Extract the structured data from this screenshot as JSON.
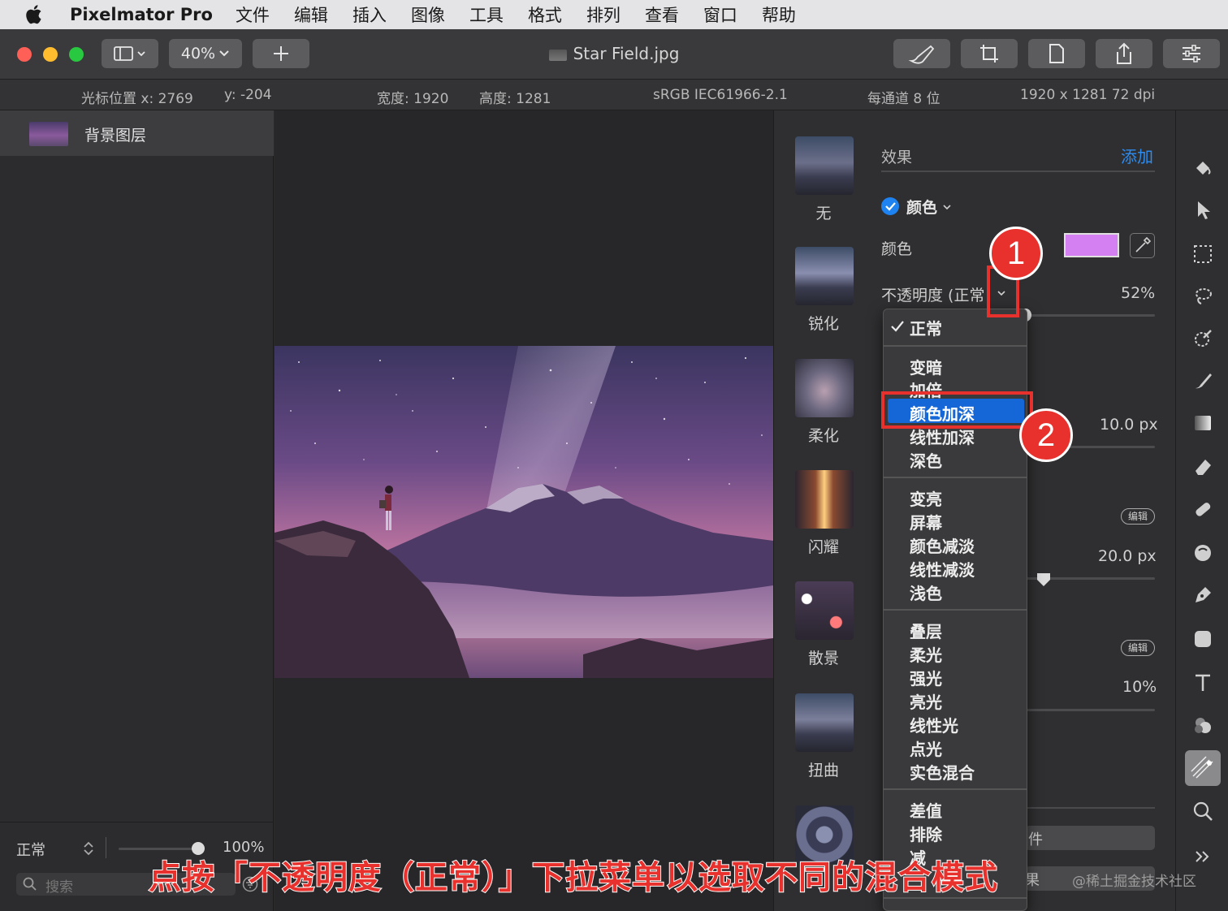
{
  "menubar": {
    "app_name": "Pixelmator Pro",
    "items": [
      "文件",
      "编辑",
      "插入",
      "图像",
      "工具",
      "格式",
      "排列",
      "查看",
      "窗口",
      "帮助"
    ]
  },
  "toolbar": {
    "zoom": "40%",
    "doc_title": "Star Field.jpg"
  },
  "infobar": {
    "cursor_x": "光标位置 x:  2769",
    "cursor_y": "y:  -204",
    "width": "宽度:  1920",
    "height": "高度:  1281",
    "profile": "sRGB IEC61966-2.1",
    "depth": "每通道 8 位",
    "size": "1920 x 1281 72 dpi"
  },
  "layers": {
    "layer_name": "背景图层",
    "blend_mode": "正常",
    "opacity": "100%",
    "opacity_value": 1.0,
    "search_placeholder": "搜索"
  },
  "effects_col": {
    "items": [
      "无",
      "锐化",
      "柔化",
      "闪耀",
      "散景",
      "扭曲"
    ]
  },
  "settings": {
    "header": "效果",
    "add": "添加",
    "effect_name": "颜色",
    "color_label": "颜色",
    "swatch_color": "#d580f2",
    "opacity_label": "不透明度 (正常",
    "opacity_value": "52%",
    "value_px1": "10.0 px",
    "edit_label": "编辑",
    "value_px2": "20.0 px",
    "value_pct": "10%",
    "partial_text1": "件",
    "partial_text2": "果"
  },
  "blend_menu": {
    "checked": "正常",
    "group1": [
      "变暗",
      "加倍",
      "颜色加深",
      "线性加深",
      "深色"
    ],
    "group2": [
      "变亮",
      "屏幕",
      "颜色减淡",
      "线性减淡",
      "浅色"
    ],
    "group3": [
      "叠层",
      "柔光",
      "强光",
      "亮光",
      "线性光",
      "点光",
      "实色混合"
    ],
    "group4": [
      "差值",
      "排除",
      "减"
    ],
    "selected": "颜色加深"
  },
  "callouts": {
    "one": "1",
    "two": "2"
  },
  "caption": "点按「不透明度（正常）」下拉菜单以选取不同的混合模式",
  "watermark": "@稀土掘金技术社区",
  "colors": {
    "accent": "#1566d6",
    "callout": "#e8302c",
    "add_link": "#2d8cf0"
  }
}
